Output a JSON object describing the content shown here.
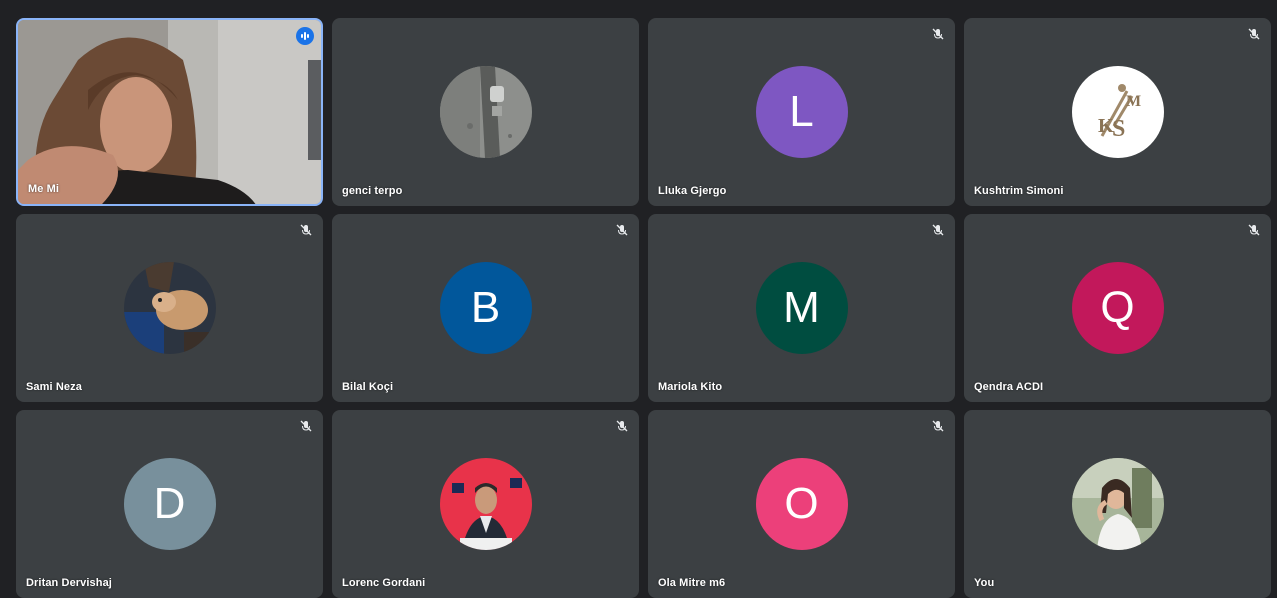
{
  "participants": [
    {
      "name": "Me Mi",
      "muted": false,
      "speaking": true,
      "type": "video"
    },
    {
      "name": "genci terpo",
      "muted": false,
      "type": "photo",
      "photo": "street-photo"
    },
    {
      "name": "Lluka Gjergo",
      "muted": true,
      "type": "letter",
      "letter": "L",
      "color": "#7e57c2"
    },
    {
      "name": "Kushtrim Simoni",
      "muted": true,
      "type": "photo",
      "photo": "ks-logo"
    },
    {
      "name": "Sami Neza",
      "muted": true,
      "type": "photo",
      "photo": "dog-photo"
    },
    {
      "name": "Bilal Koçi",
      "muted": true,
      "type": "letter",
      "letter": "B",
      "color": "#01579b"
    },
    {
      "name": "Mariola Kito",
      "muted": true,
      "type": "letter",
      "letter": "M",
      "color": "#004d40"
    },
    {
      "name": "Qendra ACDI",
      "muted": true,
      "type": "letter",
      "letter": "Q",
      "color": "#c2185b"
    },
    {
      "name": "Dritan Dervishaj",
      "muted": true,
      "type": "letter",
      "letter": "D",
      "color": "#78909c"
    },
    {
      "name": "Lorenc Gordani",
      "muted": true,
      "type": "photo",
      "photo": "speaker-photo"
    },
    {
      "name": "Ola Mitre m6",
      "muted": true,
      "type": "letter",
      "letter": "O",
      "color": "#ec407a"
    },
    {
      "name": "You",
      "muted": false,
      "type": "photo",
      "photo": "woman-photo"
    }
  ]
}
